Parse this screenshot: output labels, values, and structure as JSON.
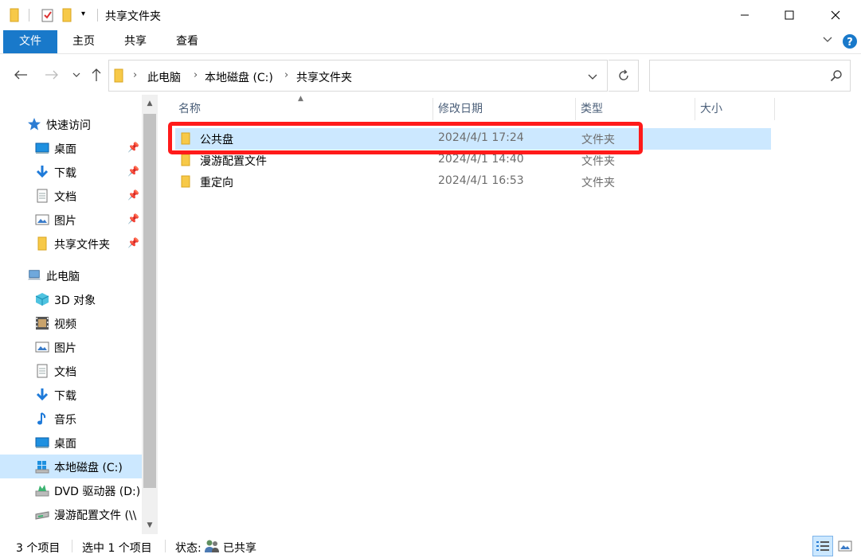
{
  "window": {
    "title": "共享文件夹"
  },
  "ribbon": {
    "tabs": [
      {
        "label": "文件"
      },
      {
        "label": "主页"
      },
      {
        "label": "共享"
      },
      {
        "label": "查看"
      }
    ]
  },
  "address": {
    "crumbs": [
      "此电脑",
      "本地磁盘 (C:)",
      "共享文件夹"
    ],
    "search_placeholder": ""
  },
  "nav": {
    "quick_access": "快速访问",
    "quick_items": [
      {
        "label": "桌面",
        "icon": "desktop-icon"
      },
      {
        "label": "下载",
        "icon": "download-icon"
      },
      {
        "label": "文档",
        "icon": "document-icon"
      },
      {
        "label": "图片",
        "icon": "picture-icon"
      },
      {
        "label": "共享文件夹",
        "icon": "folder-icon"
      }
    ],
    "this_pc": "此电脑",
    "pc_items": [
      {
        "label": "3D 对象",
        "icon": "3d-objects-icon"
      },
      {
        "label": "视频",
        "icon": "video-icon"
      },
      {
        "label": "图片",
        "icon": "picture-icon"
      },
      {
        "label": "文档",
        "icon": "document-icon"
      },
      {
        "label": "下载",
        "icon": "download-icon"
      },
      {
        "label": "音乐",
        "icon": "music-icon"
      },
      {
        "label": "桌面",
        "icon": "desktop-icon"
      },
      {
        "label": "本地磁盘 (C:)",
        "icon": "drive-icon"
      },
      {
        "label": "DVD 驱动器 (D:)",
        "icon": "dvd-icon"
      },
      {
        "label": "漫游配置文件 (\\\\",
        "icon": "network-drive-icon"
      }
    ]
  },
  "columns": {
    "name": "名称",
    "date": "修改日期",
    "type": "类型",
    "size": "大小"
  },
  "files": [
    {
      "name": "公共盘",
      "date": "2024/4/1 17:24",
      "type": "文件夹"
    },
    {
      "name": "漫游配置文件",
      "date": "2024/4/1 14:40",
      "type": "文件夹"
    },
    {
      "name": "重定向",
      "date": "2024/4/1 16:53",
      "type": "文件夹"
    }
  ],
  "status": {
    "count": "3 个项目",
    "selected": "选中 1 个项目",
    "state_label": "状态:",
    "state_value": "已共享"
  },
  "colors": {
    "accent": "#1979ca",
    "selection": "#cce8ff",
    "highlight": "#ff1a1a",
    "folder": "#f7c948"
  }
}
